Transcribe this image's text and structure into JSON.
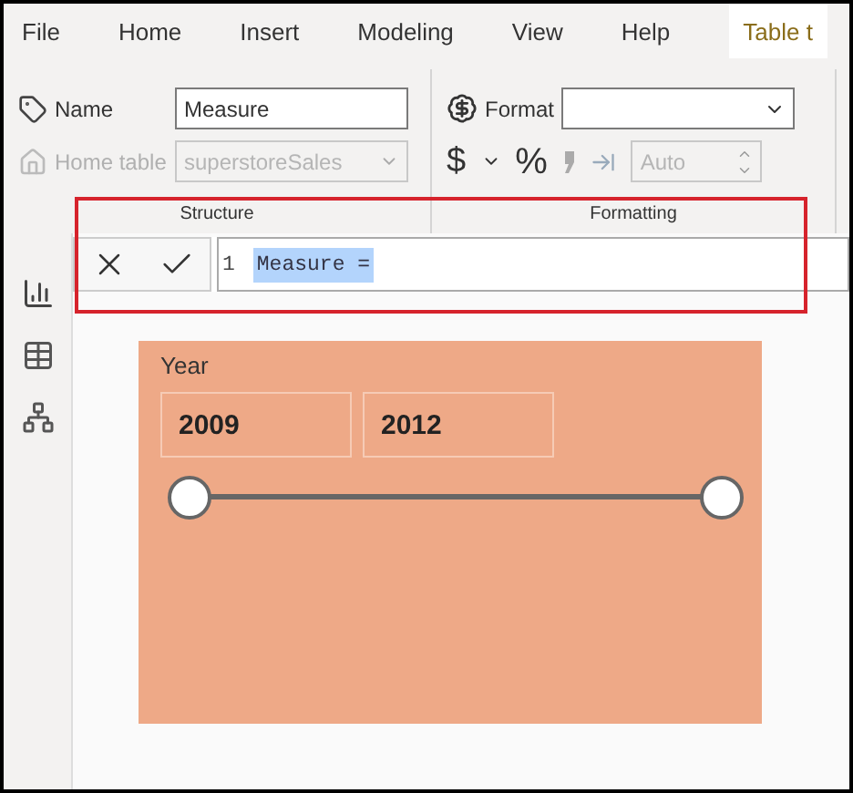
{
  "menu_tabs": [
    {
      "label": "File",
      "selected": false
    },
    {
      "label": "Home",
      "selected": false
    },
    {
      "label": "Insert",
      "selected": false
    },
    {
      "label": "Modeling",
      "selected": false
    },
    {
      "label": "View",
      "selected": false
    },
    {
      "label": "Help",
      "selected": false
    },
    {
      "label": "Table t",
      "selected": true
    }
  ],
  "ribbon": {
    "structure": {
      "label": "Structure",
      "name_field": {
        "label": "Name",
        "value": "Measure",
        "disabled": false
      },
      "home_table": {
        "label": "Home table",
        "value": "superstoreSales",
        "disabled": true
      }
    },
    "formatting": {
      "label": "Formatting",
      "format_label": "Format",
      "currency_button": "$",
      "percent_button": "%",
      "decimals": {
        "placeholder": "Auto",
        "disabled": true
      }
    }
  },
  "formula_bar": {
    "line_number": "1",
    "text": "Measure =",
    "selected": true
  },
  "slicer": {
    "title": "Year",
    "start": "2009",
    "end": "2012",
    "handles": [
      {
        "level": 0
      },
      {
        "level": 1
      }
    ]
  }
}
